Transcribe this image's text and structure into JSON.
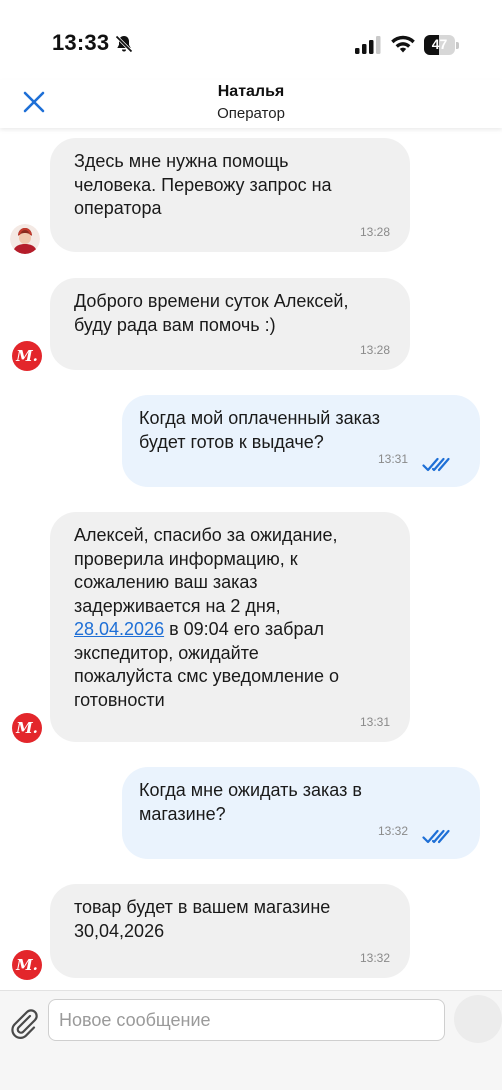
{
  "status_bar": {
    "time": "13:33",
    "battery_level": "47",
    "battery_fraction": 0.47,
    "icons": [
      "bell-slash-icon",
      "signal-icon",
      "wifi-icon",
      "battery-icon"
    ]
  },
  "header": {
    "title": "Наталья",
    "subtitle": "Оператор",
    "close_icon": "close-icon"
  },
  "messages": [
    {
      "direction": "in",
      "avatar": "operator-photo",
      "text": "Здесь мне нужна помощь\nчеловека. Перевожу запрос на\nоператора",
      "time": "13:28"
    },
    {
      "direction": "in",
      "avatar": "brand-logo",
      "avatar_letter": "М.",
      "text": "Доброго времени суток  Алексей,\nбуду рада вам помочь :)",
      "time": "13:28"
    },
    {
      "direction": "out",
      "text": "Когда мой оплаченный заказ\nбудет готов к выдаче?",
      "time": "13:31",
      "status": "read"
    },
    {
      "direction": "in",
      "avatar": "brand-logo",
      "avatar_letter": "М.",
      "text_before": "Алексей,  спасибо за ожидание,\nпроверила  информацию,  к\nсожалению ваш заказ\nзадерживается на 2 дня,\n",
      "link": "28.04.2026",
      "text_after": "  в 09:04 его забрал\nэкспедитор, ожидайте\nпожалуйста смс уведомление о\nготовности",
      "time": "13:31"
    },
    {
      "direction": "out",
      "text": "Когда мне ожидать заказ в\nмагазине?",
      "time": "13:32",
      "status": "read"
    },
    {
      "direction": "in",
      "avatar": "brand-logo",
      "avatar_letter": "М.",
      "text": "товар будет в вашем магазине\n30,04,2026",
      "time": "13:32"
    }
  ],
  "composer": {
    "placeholder": "Новое сообщение",
    "value": "",
    "attach_icon": "paperclip-icon"
  },
  "colors": {
    "accent": "#1e6fd6",
    "brand": "#e3262b",
    "incoming_bubble": "#f0f0f0",
    "outgoing_bubble": "#eaf3fd"
  }
}
